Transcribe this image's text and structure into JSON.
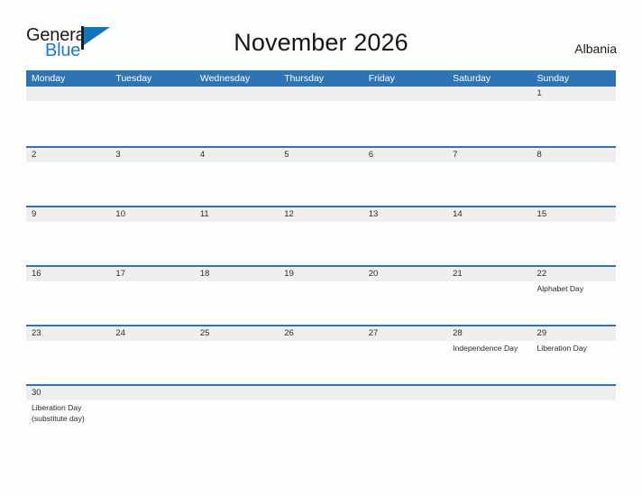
{
  "brand": {
    "name_part1": "General",
    "name_part2": "Blue",
    "flag_icon": "flag-icon",
    "colors": {
      "general_text": "#1a1a1a",
      "blue_text": "#1f7ac4",
      "flag_blue": "#1075bd"
    }
  },
  "header": {
    "title": "November 2026",
    "country": "Albania"
  },
  "theme": {
    "header_blue": "#2e74b5",
    "date_band_gray": "#efefef",
    "page_background": "#fdfdfd",
    "text_color": "#2a2a2a"
  },
  "calendar": {
    "weekdays": [
      "Monday",
      "Tuesday",
      "Wednesday",
      "Thursday",
      "Friday",
      "Saturday",
      "Sunday"
    ],
    "weeks": [
      [
        {
          "date": "",
          "events": []
        },
        {
          "date": "",
          "events": []
        },
        {
          "date": "",
          "events": []
        },
        {
          "date": "",
          "events": []
        },
        {
          "date": "",
          "events": []
        },
        {
          "date": "",
          "events": []
        },
        {
          "date": "1",
          "events": []
        }
      ],
      [
        {
          "date": "2",
          "events": []
        },
        {
          "date": "3",
          "events": []
        },
        {
          "date": "4",
          "events": []
        },
        {
          "date": "5",
          "events": []
        },
        {
          "date": "6",
          "events": []
        },
        {
          "date": "7",
          "events": []
        },
        {
          "date": "8",
          "events": []
        }
      ],
      [
        {
          "date": "9",
          "events": []
        },
        {
          "date": "10",
          "events": []
        },
        {
          "date": "11",
          "events": []
        },
        {
          "date": "12",
          "events": []
        },
        {
          "date": "13",
          "events": []
        },
        {
          "date": "14",
          "events": []
        },
        {
          "date": "15",
          "events": []
        }
      ],
      [
        {
          "date": "16",
          "events": []
        },
        {
          "date": "17",
          "events": []
        },
        {
          "date": "18",
          "events": []
        },
        {
          "date": "19",
          "events": []
        },
        {
          "date": "20",
          "events": []
        },
        {
          "date": "21",
          "events": []
        },
        {
          "date": "22",
          "events": [
            "Alphabet Day"
          ]
        }
      ],
      [
        {
          "date": "23",
          "events": []
        },
        {
          "date": "24",
          "events": []
        },
        {
          "date": "25",
          "events": []
        },
        {
          "date": "26",
          "events": []
        },
        {
          "date": "27",
          "events": []
        },
        {
          "date": "28",
          "events": [
            "Independence Day"
          ]
        },
        {
          "date": "29",
          "events": [
            "Liberation Day"
          ]
        }
      ],
      [
        {
          "date": "30",
          "events": [
            "Liberation Day",
            "(substitute day)"
          ]
        },
        {
          "date": "",
          "events": []
        },
        {
          "date": "",
          "events": []
        },
        {
          "date": "",
          "events": []
        },
        {
          "date": "",
          "events": []
        },
        {
          "date": "",
          "events": []
        },
        {
          "date": "",
          "events": []
        }
      ]
    ]
  }
}
